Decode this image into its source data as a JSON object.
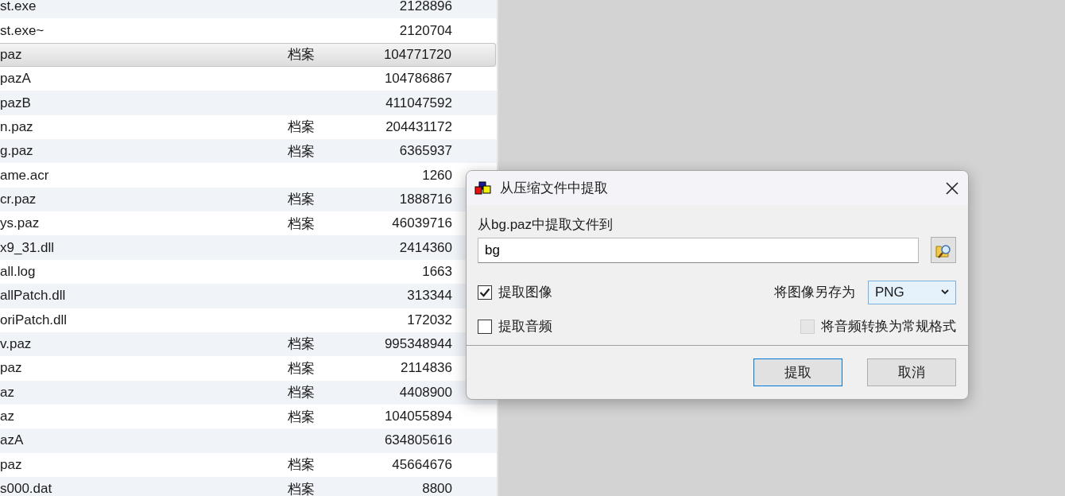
{
  "file_list": {
    "rows": [
      {
        "name": "st.exe",
        "size": "2128896",
        "selected": false
      },
      {
        "name": "st.exe~",
        "size": "2120704",
        "selected": false
      },
      {
        "name": "paz",
        "type": "档案",
        "size": "104771720",
        "selected": true
      },
      {
        "name": "pazA",
        "size": "104786867",
        "selected": false
      },
      {
        "name": "pazB",
        "size": "411047592",
        "selected": false
      },
      {
        "name": "n.paz",
        "type": "档案",
        "size": "204431172",
        "selected": false
      },
      {
        "name": "g.paz",
        "type": "档案",
        "size": "6365937",
        "selected": false
      },
      {
        "name": "ame.acr",
        "size": "1260",
        "selected": false
      },
      {
        "name": "cr.paz",
        "type": "档案",
        "size": "1888716",
        "selected": false
      },
      {
        "name": "ys.paz",
        "type": "档案",
        "size": "46039716",
        "selected": false
      },
      {
        "name": "x9_31.dll",
        "size": "2414360",
        "selected": false
      },
      {
        "name": "all.log",
        "size": "1663",
        "selected": false
      },
      {
        "name": "allPatch.dll",
        "size": "313344",
        "selected": false
      },
      {
        "name": "oriPatch.dll",
        "size": "172032",
        "selected": false
      },
      {
        "name": "v.paz",
        "type": "档案",
        "size": "995348944",
        "selected": false
      },
      {
        "name": "paz",
        "type": "档案",
        "size": "2114836",
        "selected": false
      },
      {
        "name": "az",
        "type": "档案",
        "size": "4408900",
        "selected": false
      },
      {
        "name": "az",
        "type": "档案",
        "size": "104055894",
        "selected": false
      },
      {
        "name": "azA",
        "size": "634805616",
        "selected": false
      },
      {
        "name": "paz",
        "type": "档案",
        "size": "45664676",
        "selected": false
      },
      {
        "name": "s000.dat",
        "type": "档案",
        "size": "8800",
        "selected": false
      }
    ]
  },
  "dialog": {
    "title": "从压缩文件中提取",
    "destination": {
      "label": "从bg.paz中提取文件到",
      "value": "bg"
    },
    "extract_images": {
      "label": "提取图像",
      "checked": true
    },
    "save_as": {
      "label": "将图像另存为",
      "value": "PNG"
    },
    "extract_audio": {
      "label": "提取音频",
      "checked": false
    },
    "convert_audio": {
      "label": "将音频转换为常规格式",
      "checked": false,
      "disabled": true
    },
    "buttons": [
      {
        "label": "提取",
        "default": true
      },
      {
        "label": "取消",
        "default": false
      }
    ]
  }
}
